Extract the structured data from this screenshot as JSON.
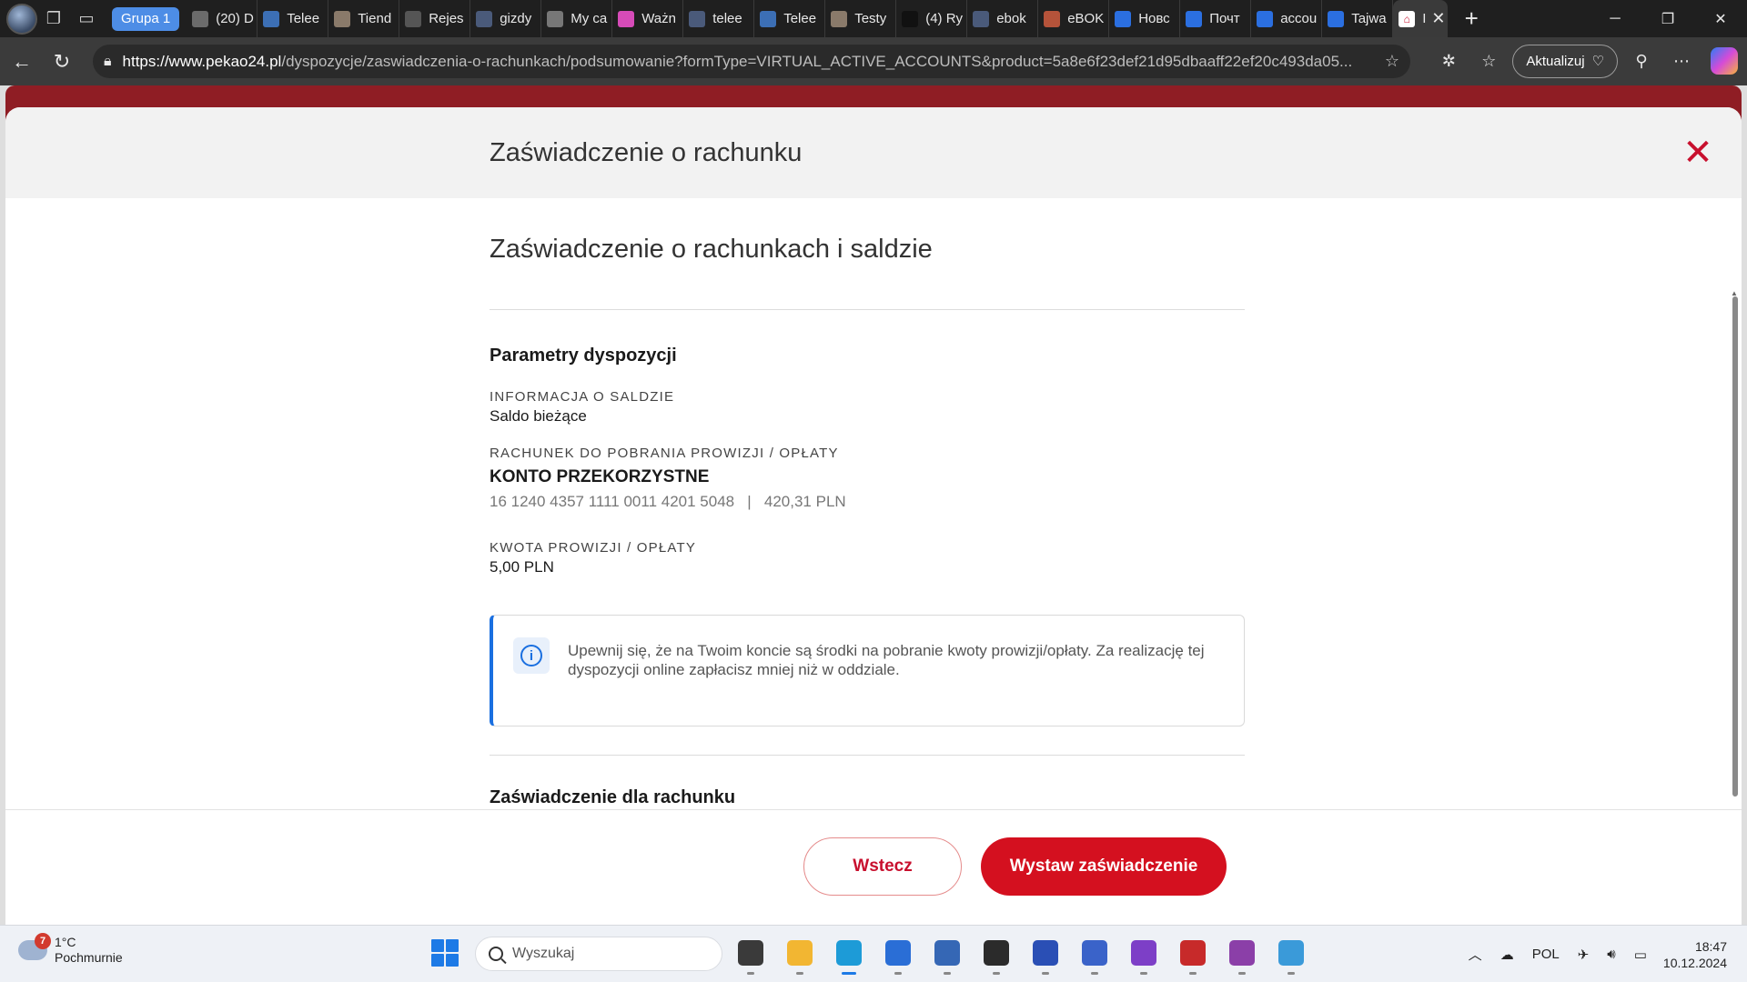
{
  "browser": {
    "group_label": "Grupa 1",
    "tabs": [
      {
        "label": "(20) D",
        "color": "#6b6b6b"
      },
      {
        "label": "Telee",
        "color": "#3c6fb5"
      },
      {
        "label": "Tiend",
        "color": "#8a7a6a"
      },
      {
        "label": "Rejes",
        "color": "#555555"
      },
      {
        "label": "gizdy",
        "color": "#4a5a7a"
      },
      {
        "label": "My ca",
        "color": "#777777"
      },
      {
        "label": "Ważn",
        "color": "#d64bb8"
      },
      {
        "label": "telee",
        "color": "#4a5a7a"
      },
      {
        "label": "Telee",
        "color": "#3c6fb5"
      },
      {
        "label": "Testy",
        "color": "#8a7a6a"
      },
      {
        "label": "(4) Ry",
        "color": "#111111"
      },
      {
        "label": "ebok",
        "color": "#4a5a7a"
      },
      {
        "label": "eBOK",
        "color": "#b5533a"
      },
      {
        "label": "Новс",
        "color": "#2b6fe0"
      },
      {
        "label": "Почт",
        "color": "#2b6fe0"
      },
      {
        "label": "accou",
        "color": "#2b6fe0"
      },
      {
        "label": "Tajwa",
        "color": "#2b6fe0"
      }
    ],
    "active_tab_label": "I",
    "url_domain": "https://www.pekao24.pl",
    "url_path": "/dyspozycje/zaswiadczenia-o-rachunkach/podsumowanie?formType=VIRTUAL_ACTIVE_ACCOUNTS&product=5a8e6f23def21d95dbaaff22ef20c493da05...",
    "update_label": "Aktualizuj"
  },
  "modal": {
    "header_title": "Zaświadczenie o rachunku",
    "heading": "Zaświadczenie o rachunkach i saldzie",
    "params_title": "Parametry dyspozycji",
    "balance_label": "INFORMACJA O SALDZIE",
    "balance_value": "Saldo bieżące",
    "fee_account_label": "RACHUNEK DO POBRANIA PROWIZJI / OPŁATY",
    "account_name": "KONTO PRZEKORZYSTNE",
    "account_number": "16 1240 4357 1111 0011 4201 5048",
    "account_separator": "|",
    "account_balance": "420,31 PLN",
    "fee_amount_label": "KWOTA PROWIZJI / OPŁATY",
    "fee_amount_value": "5,00 PLN",
    "info_text": "Upewnij się, że na Twoim koncie są środki na pobranie kwoty prowizji/opłaty. Za realizację tej dyspozycji online zapłacisz mniej niż w oddziale.",
    "next_section_title": "Zaświadczenie dla rachunku",
    "back_button": "Wstecz",
    "issue_button": "Wystaw zaświadczenie"
  },
  "taskbar": {
    "weather_temp": "1°C",
    "weather_desc": "Pochmurnie",
    "weather_badge": "7",
    "search_placeholder": "Wyszukaj",
    "language": "POL",
    "time": "18:47",
    "date": "10.12.2024",
    "apps": [
      {
        "name": "task-view",
        "color": "#3a3a3a",
        "active": false
      },
      {
        "name": "file-explorer",
        "color": "#f2b632",
        "active": false
      },
      {
        "name": "edge",
        "color": "#1d9bd7",
        "active": true
      },
      {
        "name": "microsoft-store",
        "color": "#2a6ed6",
        "active": false
      },
      {
        "name": "network-app",
        "color": "#3567b5",
        "active": false
      },
      {
        "name": "terminal",
        "color": "#2b2b2b",
        "active": false
      },
      {
        "name": "save-app",
        "color": "#2a4fb5",
        "active": false
      },
      {
        "name": "letter-a-app",
        "color": "#3a63c9",
        "active": false
      },
      {
        "name": "tor-browser",
        "color": "#7d3fc7",
        "active": false
      },
      {
        "name": "red-app",
        "color": "#c72a2a",
        "active": false
      },
      {
        "name": "github-app",
        "color": "#8b3fa8",
        "active": false
      },
      {
        "name": "notepad",
        "color": "#3a9ad9",
        "active": false
      }
    ]
  }
}
